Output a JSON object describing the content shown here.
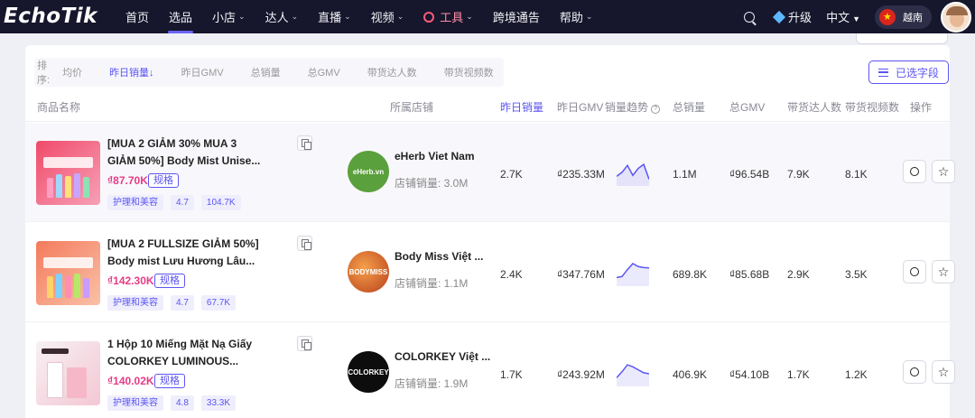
{
  "brand": {
    "logo_text": "EchoTik"
  },
  "nav": {
    "items": [
      {
        "label": "首页",
        "chevron": false
      },
      {
        "label": "选品",
        "chevron": true,
        "active": true
      },
      {
        "label": "小店",
        "chevron": true
      },
      {
        "label": "达人",
        "chevron": true
      },
      {
        "label": "直播",
        "chevron": true
      },
      {
        "label": "视频",
        "chevron": true
      },
      {
        "label": "工具",
        "chevron": true,
        "tool": true
      },
      {
        "label": "跨境通告",
        "chevron": false
      },
      {
        "label": "帮助",
        "chevron": true
      }
    ],
    "upgrade_label": "升级",
    "language_label": "中文",
    "region_label": "越南"
  },
  "toolbar": {
    "sort_label": "排序:",
    "sort_options": [
      "均价",
      "昨日销量↓",
      "昨日GMV",
      "总销量",
      "总GMV",
      "带货达人数",
      "带货视频数"
    ],
    "active_sort_index": 1,
    "selected_fields_label": "已选字段"
  },
  "table": {
    "headers": {
      "product": "商品名称",
      "shop": "所属店铺",
      "yesterday_sales": "昨日销量",
      "yesterday_gmv": "昨日GMV",
      "trend": "销量趋势",
      "total_sales": "总销量",
      "total_gmv": "总GMV",
      "creators": "带货达人数",
      "videos": "带货视频数",
      "actions": "操作"
    },
    "rows": [
      {
        "title_line1": "[MUA 2 GIẢM 30% MUA 3",
        "title_line2": "GIẢM 50%] Body Mist Unise...",
        "price": "₫87.70K",
        "spec_label": "规格",
        "category": "护理和美容",
        "rating": "4.7",
        "reviews": "104.7K",
        "shop_name": "eHerb Viet Nam",
        "shop_sales": "店铺销量: 3.0M",
        "shop_logo_text": "eHerb.vn",
        "yesterday_sales": "2.7K",
        "yesterday_gmv": "₫235.33M",
        "trend": [
          0.35,
          0.55,
          0.9,
          0.4,
          0.75,
          0.95,
          0.2
        ],
        "total_sales": "1.1M",
        "total_gmv": "₫96.54B",
        "creators": "7.9K",
        "videos": "8.1K"
      },
      {
        "title_line1": "[MUA 2 FULLSIZE GIẢM 50%]",
        "title_line2": "Body mist Lưu Hương Lâu...",
        "price": "₫142.30K",
        "spec_label": "规格",
        "category": "护理和美容",
        "rating": "4.7",
        "reviews": "67.7K",
        "shop_name": "Body Miss Việt ...",
        "shop_sales": "店铺销量: 1.1M",
        "shop_logo_text": "BODYMISS",
        "yesterday_sales": "2.4K",
        "yesterday_gmv": "₫347.76M",
        "trend": [
          0.3,
          0.35,
          0.7,
          1.0,
          0.85,
          0.8,
          0.78
        ],
        "total_sales": "689.8K",
        "total_gmv": "₫85.68B",
        "creators": "2.9K",
        "videos": "3.5K"
      },
      {
        "title_line1": "1 Hộp 10 Miếng Mặt Nạ Giấy",
        "title_line2": "COLORKEY LUMINOUS...",
        "price": "₫140.02K",
        "spec_label": "规格",
        "category": "护理和美容",
        "rating": "4.8",
        "reviews": "33.3K",
        "shop_name": "COLORKEY Việt ...",
        "shop_sales": "店铺销量: 1.9M",
        "shop_logo_text": "COLORKEY",
        "yesterday_sales": "1.7K",
        "yesterday_gmv": "₫243.92M",
        "trend": [
          0.3,
          0.6,
          0.95,
          0.85,
          0.7,
          0.55,
          0.5
        ],
        "total_sales": "406.9K",
        "total_gmv": "₫54.10B",
        "creators": "1.7K",
        "videos": "1.2K"
      }
    ]
  },
  "colors": {
    "accent": "#5b55f2",
    "price": "#e63b86",
    "nav_bg": "#16162c",
    "trend_line": "#5b55f2"
  },
  "icons": {
    "search": "search-icon",
    "upgrade": "gem-icon",
    "region": "vietnam-flag-icon",
    "copy": "copy-icon",
    "action_1": "circle-icon",
    "action_2": "star-icon"
  }
}
